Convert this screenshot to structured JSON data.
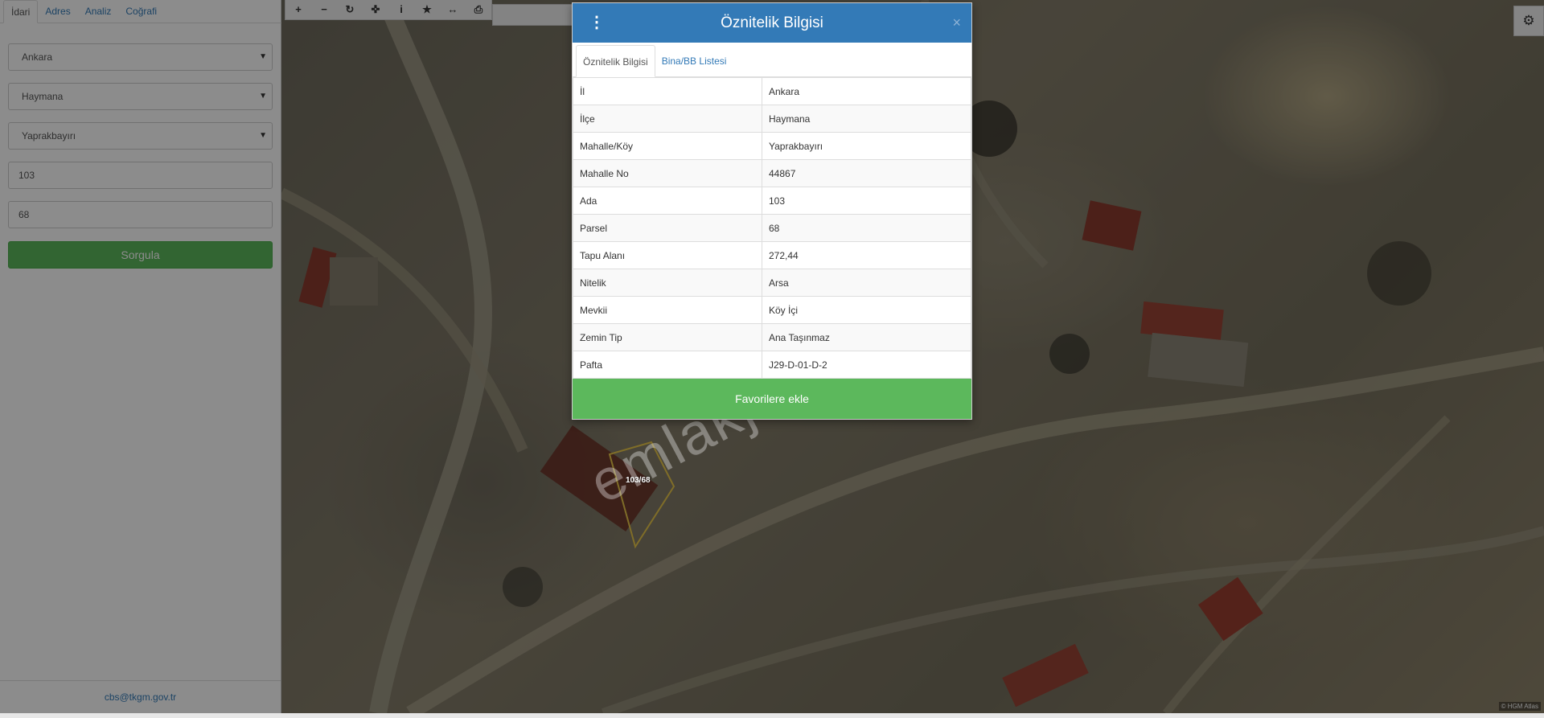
{
  "sidebar": {
    "tabs": [
      {
        "label": "İdari",
        "active": true
      },
      {
        "label": "Adres",
        "active": false
      },
      {
        "label": "Analiz",
        "active": false
      },
      {
        "label": "Coğrafi",
        "active": false
      }
    ],
    "il_select": "Ankara",
    "ilce_select": "Haymana",
    "mahalle_select": "Yaprakbayırı",
    "ada_input": "103",
    "parsel_input": "68",
    "submit_label": "Sorgula",
    "footer_email": "cbs@tkgm.gov.tr"
  },
  "toolbar": {
    "icons": [
      "zoom-in-icon",
      "zoom-out-icon",
      "refresh-icon",
      "locate-icon",
      "info-icon",
      "favorite-icon",
      "measure-icon",
      "print-icon"
    ]
  },
  "map": {
    "parcel_label": "103/68",
    "watermark": "emlakjet.com",
    "attribution": "© HGM Atlas"
  },
  "modal": {
    "title": "Öznitelik Bilgisi",
    "close_symbol": "×",
    "tabs": [
      {
        "label": "Öznitelik Bilgisi",
        "active": true
      },
      {
        "label": "Bina/BB Listesi",
        "active": false
      }
    ],
    "rows": [
      {
        "key": "İl",
        "value": "Ankara"
      },
      {
        "key": "İlçe",
        "value": "Haymana"
      },
      {
        "key": "Mahalle/Köy",
        "value": "Yaprakbayırı"
      },
      {
        "key": "Mahalle No",
        "value": "44867"
      },
      {
        "key": "Ada",
        "value": "103"
      },
      {
        "key": "Parsel",
        "value": "68"
      },
      {
        "key": "Tapu Alanı",
        "value": "272,44"
      },
      {
        "key": "Nitelik",
        "value": "Arsa"
      },
      {
        "key": "Mevkii",
        "value": "Köy İçi"
      },
      {
        "key": "Zemin Tip",
        "value": "Ana Taşınmaz"
      },
      {
        "key": "Pafta",
        "value": "J29-D-01-D-2"
      }
    ],
    "favorite_label": "Favorilere ekle"
  },
  "colors": {
    "primary": "#337ab7",
    "success": "#5cb85c",
    "overlay": "rgba(0,0,0,0.45)"
  }
}
